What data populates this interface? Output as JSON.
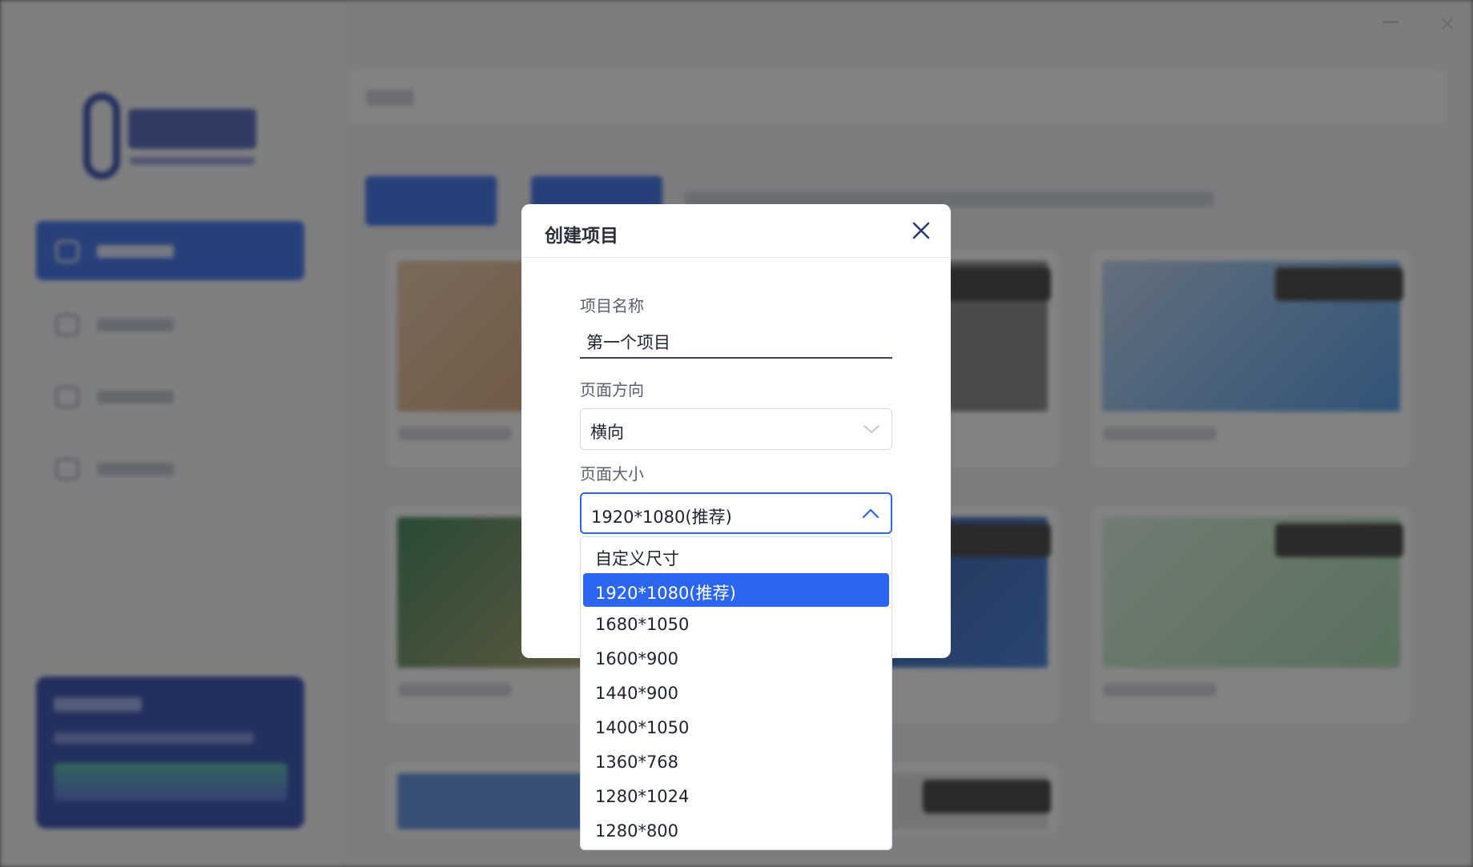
{
  "modal": {
    "title": "创建项目",
    "project_name_label": "项目名称",
    "project_name_value": "第一个项目",
    "orientation_label": "页面方向",
    "orientation_value": "横向",
    "size_label": "页面大小",
    "size_value": "1920*1080(推荐)"
  },
  "size_options": [
    "自定义尺寸",
    "1920*1080(推荐)",
    "1680*1050",
    "1600*900",
    "1440*900",
    "1400*1050",
    "1360*768",
    "1280*1024",
    "1280*800"
  ],
  "selected_option_index": 1,
  "colors": {
    "accent": "#2b66f0",
    "overlay": "#4a4a4a"
  },
  "icons": {
    "close": "close-icon",
    "chevron_down": "chevron-down-icon",
    "chevron_up": "chevron-up-icon"
  }
}
